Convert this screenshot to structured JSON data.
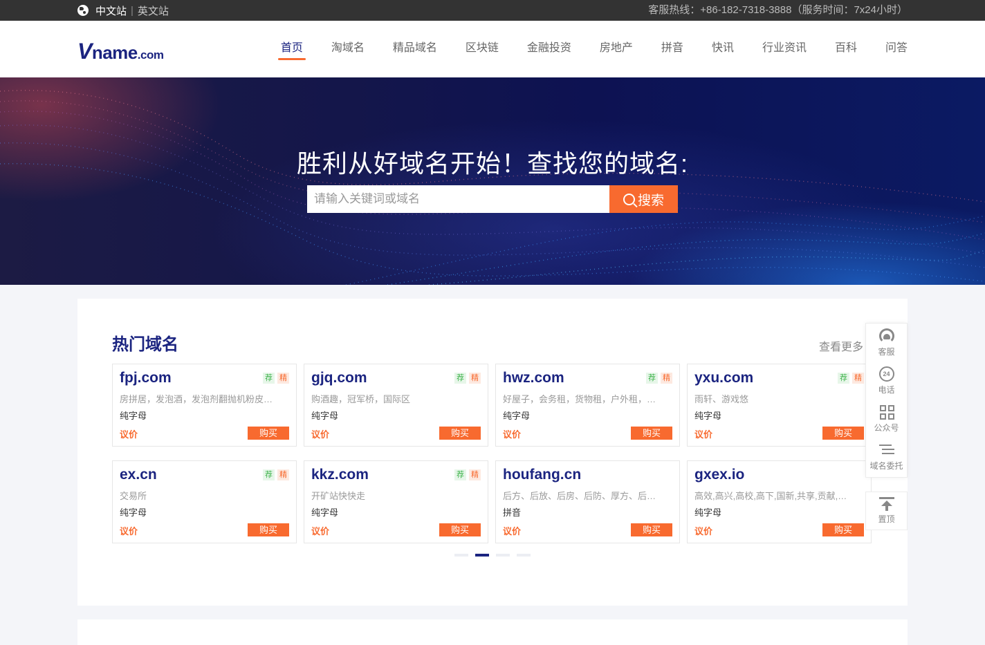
{
  "topbar": {
    "lang_current": "中文站",
    "lang_separator": "|",
    "lang_other": "英文站",
    "hotline": "客服热线：+86-182-7318-3888（服务时间：7x24小时）"
  },
  "header": {
    "logo_v": "V",
    "logo_name": "name",
    "logo_com": ".com",
    "nav": [
      "首页",
      "淘域名",
      "精品域名",
      "区块链",
      "金融投资",
      "房地产",
      "拼音",
      "快讯",
      "行业资讯",
      "百科",
      "问答"
    ],
    "active_nav": "首页"
  },
  "banner": {
    "headline": "胜利从好域名开始！查找您的域名:",
    "search_placeholder": "请输入关键词或域名",
    "search_button": "搜索"
  },
  "hot": {
    "title": "热门域名",
    "more": "查看更多",
    "tag_rec": "荐",
    "tag_fine": "精",
    "price_label": "议价",
    "buy_label": "购买",
    "cards": [
      {
        "domain": "fpj.com",
        "desc": "房拼居，发泡酒，发泡剂翻抛机粉皮…",
        "cat": "纯字母",
        "tags": true
      },
      {
        "domain": "gjq.com",
        "desc": "购酒趣，冠军桥，国际区",
        "cat": "纯字母",
        "tags": true
      },
      {
        "domain": "hwz.com",
        "desc": "好屋子，会务租，货物租，户外租，…",
        "cat": "纯字母",
        "tags": true
      },
      {
        "domain": "yxu.com",
        "desc": "雨轩、游戏悠",
        "cat": "纯字母",
        "tags": true
      },
      {
        "domain": "ex.cn",
        "desc": "交易所",
        "cat": "纯字母",
        "tags": true
      },
      {
        "domain": "kkz.com",
        "desc": "开矿站快快走",
        "cat": "纯字母",
        "tags": true
      },
      {
        "domain": "houfang.cn",
        "desc": "后方、后放、后房、后防、厚方、后…",
        "cat": "拼音",
        "tags": false
      },
      {
        "domain": "gxex.io",
        "desc": "高效,高兴,高校,高下,国新,共享,贡献,…",
        "cat": "纯字母",
        "tags": false
      }
    ],
    "pager": {
      "total": 4,
      "active": 2
    }
  },
  "side": {
    "items": [
      {
        "label": "客服",
        "icon": "customer-service-icon"
      },
      {
        "label": "电话",
        "icon": "phone-24-icon",
        "icon_text": "24"
      },
      {
        "label": "公众号",
        "icon": "qrcode-icon"
      },
      {
        "label": "域名委托",
        "icon": "entrust-list-icon"
      }
    ],
    "top_label": "置顶"
  },
  "colors": {
    "brand": "#1b2480",
    "accent": "#f86a2f",
    "topbar": "#333333"
  }
}
